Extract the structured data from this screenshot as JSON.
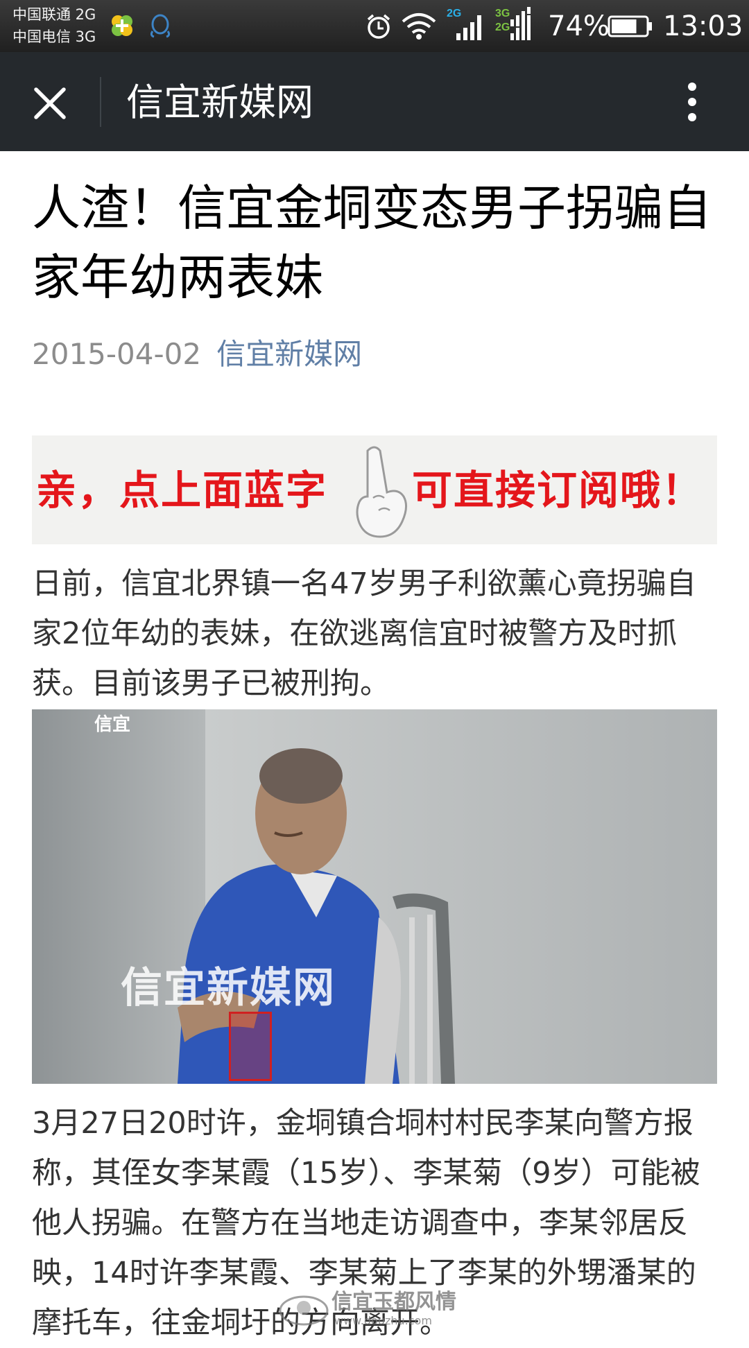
{
  "status_bar": {
    "carrier_1": "中国联通 2G",
    "carrier_2": "中国电信 3G",
    "signal_1_label": "2G",
    "signal_2_label_top": "3G",
    "signal_2_label_bottom": "2G",
    "battery_percent": "74%",
    "battery_level": 0.74,
    "time": "13:03",
    "icons": [
      "clover-app-icon",
      "qq-icon",
      "alarm-icon",
      "wifi-icon",
      "signal-icon",
      "signal-dual-icon",
      "battery-icon"
    ]
  },
  "title_bar": {
    "title": "信宜新媒网",
    "close_icon": "close-icon",
    "more_icon": "more-vertical-icon"
  },
  "article": {
    "title": "人渣！信宜金垌变态男子拐骗自家年幼两表妹",
    "date": "2015-04-02",
    "source": "信宜新媒网",
    "banner": {
      "left_text": "亲，点上面蓝字",
      "right_text": "可直接订阅哦！",
      "icon": "pointing-hand-icon"
    },
    "paragraph_1": "日前，信宜北界镇一名47岁男子利欲薰心竟拐骗自家2位年幼的表妹，在欲逃离信宜时被警方及时抓获。目前该男子已被刑拘。",
    "photo": {
      "corner_tag": "信宜",
      "watermark": "信宜新媒网"
    },
    "paragraph_2": "3月27日20时许，金垌镇合垌村村民李某向警方报称，其侄女李某霞（15岁）、李某菊（9岁）可能被他人拐骗。在警方在当地走访调查中，李某邻居反映，14时许李某霞、李某菊上了李某的外甥潘某的摩托车，往金垌圩的方向离开。",
    "page_watermark": {
      "text": "信宜玉都风情",
      "url": "www.douzhu.com"
    }
  },
  "colors": {
    "status_bar": "#2a2a2a",
    "title_bar": "#25292d",
    "source_link": "#607fa6",
    "banner_red": "#e4161b",
    "body_text": "#333333",
    "date_text": "#8c8c8c"
  }
}
